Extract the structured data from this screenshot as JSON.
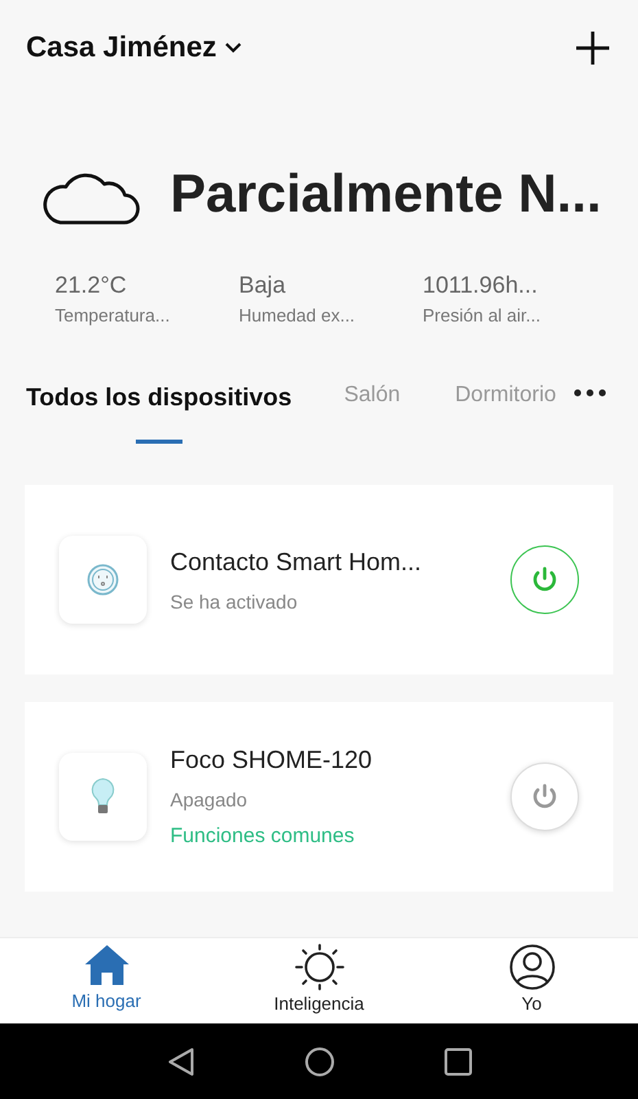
{
  "header": {
    "home_name": "Casa Jiménez"
  },
  "weather": {
    "condition": "Parcialmente N...",
    "stats": [
      {
        "value": "21.2°C",
        "label": "Temperatura..."
      },
      {
        "value": "Baja",
        "label": "Humedad ex..."
      },
      {
        "value": "1011.96h...",
        "label": "Presión al air..."
      }
    ]
  },
  "tabs": [
    {
      "label": "Todos los dispositivos",
      "selected": true
    },
    {
      "label": "Salón",
      "selected": false
    },
    {
      "label": "Dormitorio",
      "selected": false
    }
  ],
  "devices": [
    {
      "kind": "plug",
      "name": "Contacto Smart Hom...",
      "status": "Se ha activado",
      "on": true
    },
    {
      "kind": "bulb",
      "name": "Foco SHOME-120",
      "status": "Apagado",
      "link": "Funciones comunes",
      "on": false
    }
  ],
  "bottom_nav": [
    {
      "kind": "home",
      "label": "Mi hogar",
      "selected": true
    },
    {
      "kind": "sun",
      "label": "Inteligencia",
      "selected": false
    },
    {
      "kind": "user",
      "label": "Yo",
      "selected": false
    }
  ]
}
